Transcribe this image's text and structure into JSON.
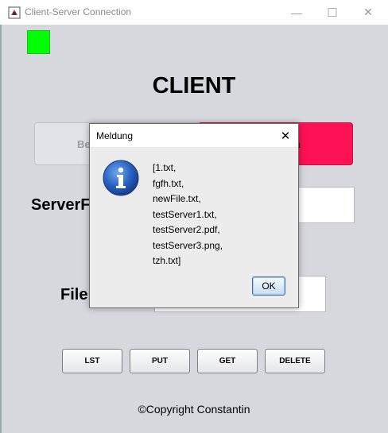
{
  "window": {
    "title": "Client-Server Connection",
    "minimize_glyph": "—",
    "maximize_glyph": "☐",
    "close_glyph": "✕"
  },
  "status": {
    "connected": true,
    "color": "#00ff00"
  },
  "heading": "CLIENT",
  "buttons": {
    "left_partial_label": "Be",
    "right_partial_label": "n",
    "right_color": "#ff1155"
  },
  "fields": {
    "server_label": "ServerF",
    "file_label": "File"
  },
  "actions": {
    "lst": "LST",
    "put": "PUT",
    "get": "GET",
    "delete": "DELETE"
  },
  "copyright": "©Copyright Constantin",
  "dialog": {
    "title": "Meldung",
    "close_glyph": "✕",
    "icon": "info-icon",
    "lines": [
      "[1.txt,",
      "fgfh.txt,",
      "newFile.txt,",
      "testServer1.txt,",
      "testServer2.pdf,",
      "testServer3.png,",
      "tzh.txt]"
    ],
    "ok_label": "OK"
  }
}
